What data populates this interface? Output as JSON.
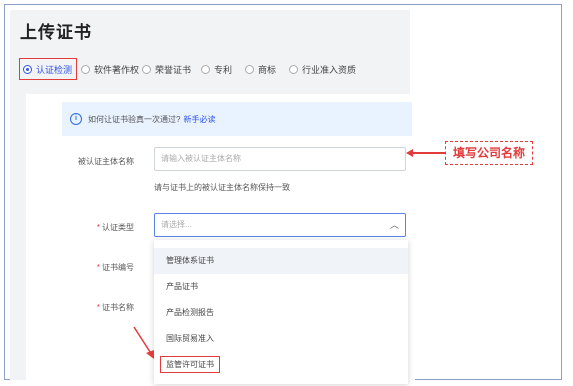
{
  "page": {
    "title": "上传证书"
  },
  "tabs": [
    {
      "label": "认证检测",
      "selected": true
    },
    {
      "label": "软件著作权",
      "selected": false
    },
    {
      "label": "荣誉证书",
      "selected": false
    },
    {
      "label": "专利",
      "selected": false
    },
    {
      "label": "商标",
      "selected": false
    },
    {
      "label": "行业准入资质",
      "selected": false
    }
  ],
  "info": {
    "text": "如何让证书验真一次通过?",
    "link": "新手必读",
    "icon": "info-icon"
  },
  "form": {
    "subject_label": "被认证主体名称",
    "subject_placeholder": "请输入被认证主体名称",
    "subject_hint": "请与证书上的被认证主体名称保持一致",
    "type_label": "认证类型",
    "type_placeholder": "请选择...",
    "number_label": "证书编号",
    "name_label": "证书名称",
    "required_mark": "*"
  },
  "dropdown": {
    "options": [
      "管理体系证书",
      "产品证书",
      "产品检测报告",
      "国际贸易准入",
      "监管许可证书"
    ]
  },
  "annotation": {
    "text": "填写公司名称"
  },
  "colors": {
    "accent": "#2f54eb",
    "annotation": "#e23b3b",
    "panel": "#f2f3f5"
  }
}
